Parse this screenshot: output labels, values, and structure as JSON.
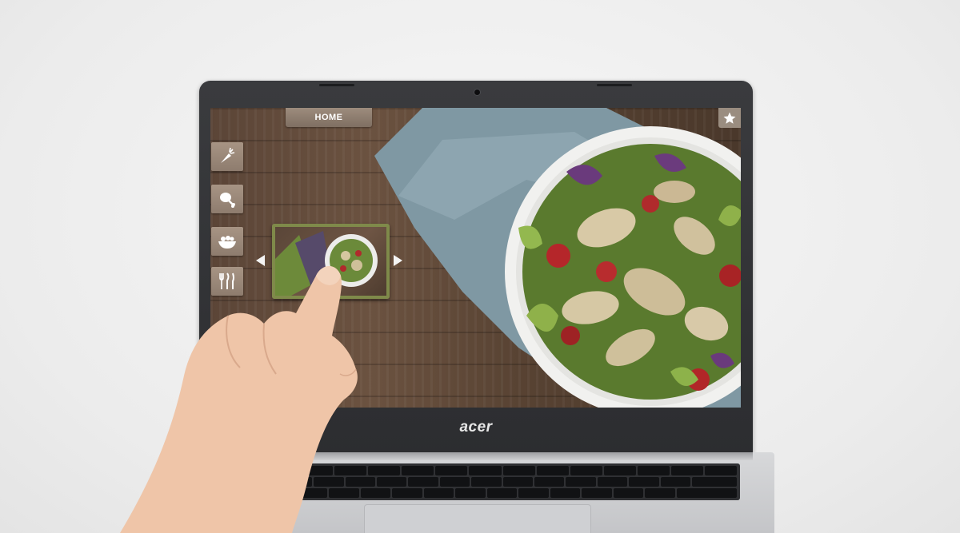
{
  "device": {
    "brand_logo": "acer"
  },
  "app": {
    "nav": {
      "home_label": "HOME"
    },
    "side_menu": [
      {
        "icon": "carrot-icon"
      },
      {
        "icon": "drumstick-icon"
      },
      {
        "icon": "salad-bowl-icon"
      },
      {
        "icon": "cutlery-icon"
      }
    ],
    "favorites_icon": "star-icon",
    "carousel": {
      "prev_icon": "chevron-left-icon",
      "next_icon": "chevron-right-icon"
    }
  },
  "colors": {
    "wood": "#5b4537",
    "button": "#9a8d80",
    "thumb_border": "#7f8a4a",
    "bezel": "#2c2d30"
  }
}
